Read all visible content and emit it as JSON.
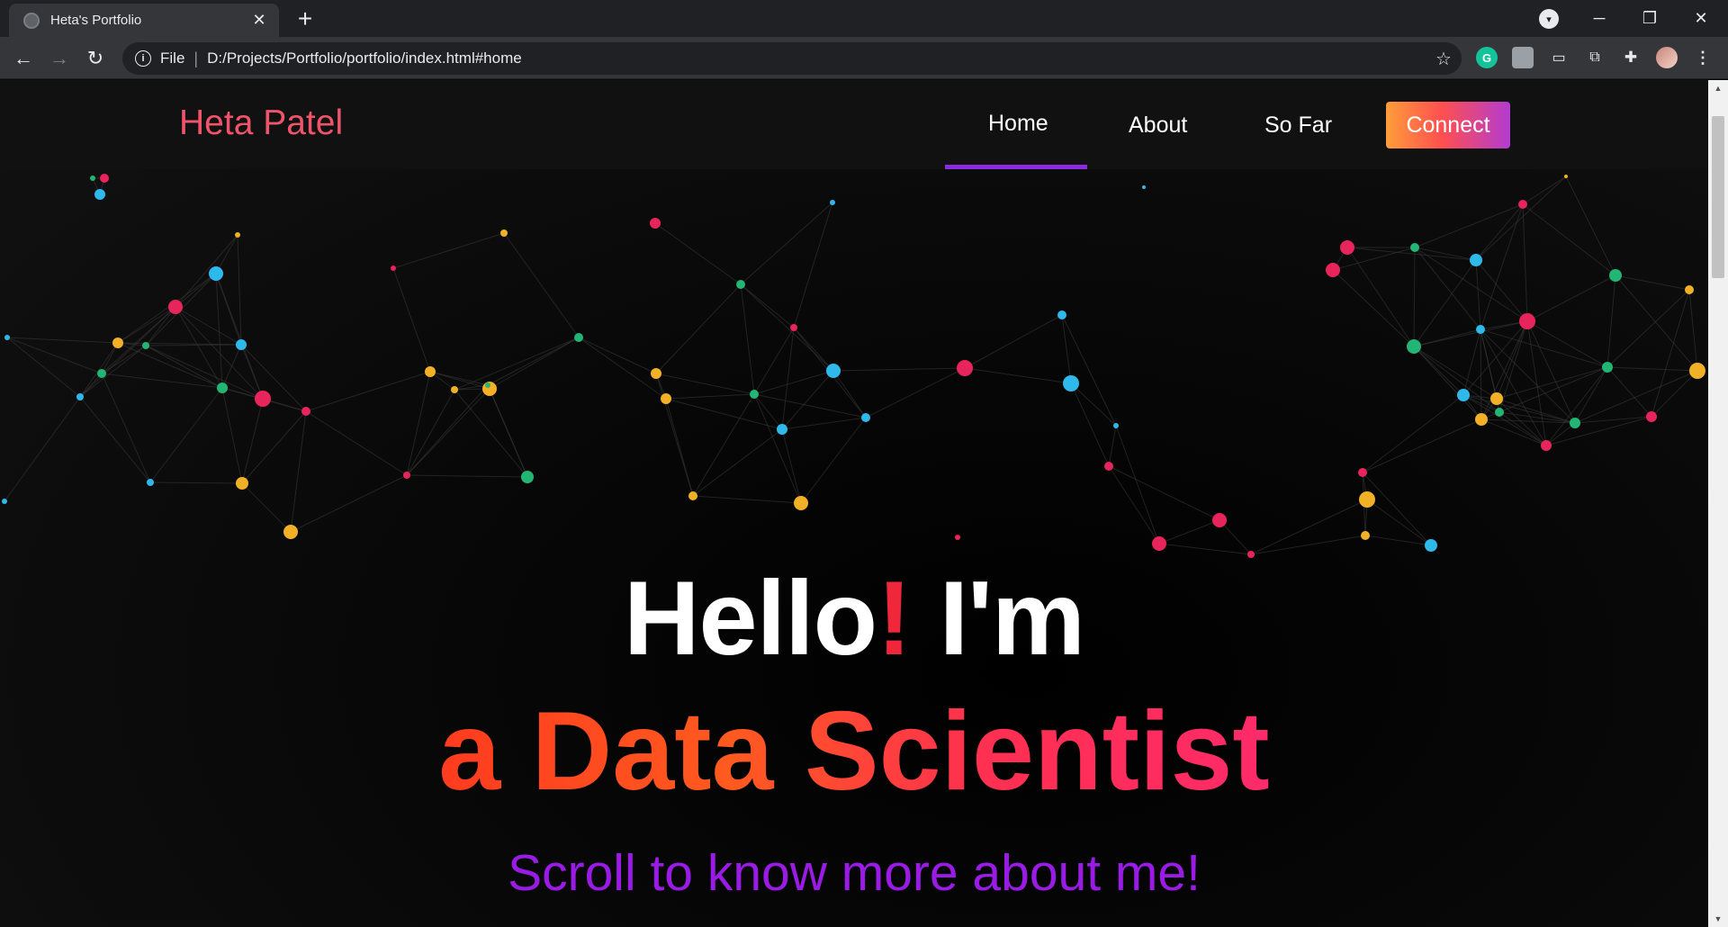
{
  "browser": {
    "tab_title": "Heta's Portfolio",
    "tab_close": "✕",
    "new_tab": "+",
    "omnibox_scheme": "File",
    "omnibox_url": "D:/Projects/Portfolio/portfolio/index.html#home",
    "window_controls": {
      "minimize": "─",
      "restore": "❐",
      "close": "✕"
    },
    "extensions": [
      "grammarly-icon",
      "extension-icon",
      "media-icon",
      "picture-in-picture-icon",
      "puzzle-icon",
      "profile-avatar"
    ]
  },
  "site": {
    "brand": "Heta Patel",
    "nav": [
      {
        "label": "Home",
        "active": true
      },
      {
        "label": "About",
        "active": false
      },
      {
        "label": "So Far",
        "active": false
      }
    ],
    "connect_label": "Connect"
  },
  "hero": {
    "hello": "Hello",
    "exclaim": "!",
    "im": " I'm",
    "role": "a Data Scientist",
    "subtitle": "Scroll to know more about me!"
  },
  "colors": {
    "brand": "#f0546a",
    "accent_purple": "#8a2be2",
    "node_colors": [
      "#e8245c",
      "#2fb9ea",
      "#f2b026",
      "#22b573"
    ]
  }
}
